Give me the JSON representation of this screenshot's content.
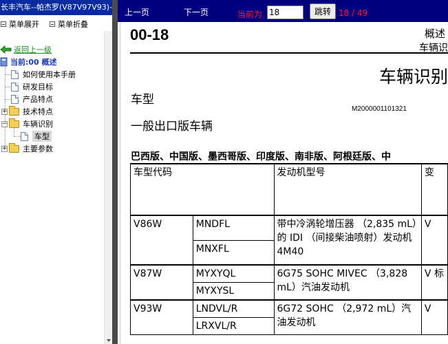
{
  "window": {
    "title": "长丰汽车--帕杰罗(V87V97V93)-"
  },
  "toolbar": {
    "expand_label": "菜单展开",
    "collapse_label": "菜单折叠"
  },
  "tree": {
    "back_label": "返回上一级",
    "current_label": "当前:00  概述",
    "items": [
      {
        "label": "如何使用本手册"
      },
      {
        "label": "研发目标"
      },
      {
        "label": "产品特点"
      },
      {
        "label": "技术特点"
      },
      {
        "label": "车辆识别"
      },
      {
        "label": "车型"
      },
      {
        "label": "主要参数"
      }
    ]
  },
  "nav": {
    "prev_label": "上一页",
    "next_label": "下一页",
    "current_label": "当前为",
    "page_value": "18",
    "jump_label": "跳转",
    "page_count": "18 / 49"
  },
  "doc": {
    "section_number": "00-18",
    "section_name": "概述",
    "section_sub": "车辆识",
    "big_title": "车辆识别",
    "heading_model": "车型",
    "code": "M2000001101321",
    "heading_export": "一般出口版车辆",
    "regions": "巴西版、中国版、墨西哥版、印度版、南非版、阿根廷版、中",
    "table": {
      "headers": [
        "车型代码",
        "发动机型号",
        "变"
      ],
      "rows": [
        {
          "model": "V86W",
          "codes": [
            "MNDFL",
            "MNXFL"
          ],
          "engine": "带中冷涡轮增压器 （2,835 mL）的 IDI （间接柴油喷射）发动机 4M40",
          "extra": "V"
        },
        {
          "model": "V87W",
          "codes": [
            "MYXYQL",
            "MYXYSL"
          ],
          "engine": "6G75 SOHC MIVEC （3,828 mL）汽油发动机",
          "extra": "V 标"
        },
        {
          "model": "V93W",
          "codes": [
            "LNDVL/R",
            "LRXVL/R"
          ],
          "engine": "6G72 SOHC （2,972 mL）汽油发动机",
          "extra": "V"
        }
      ]
    }
  }
}
